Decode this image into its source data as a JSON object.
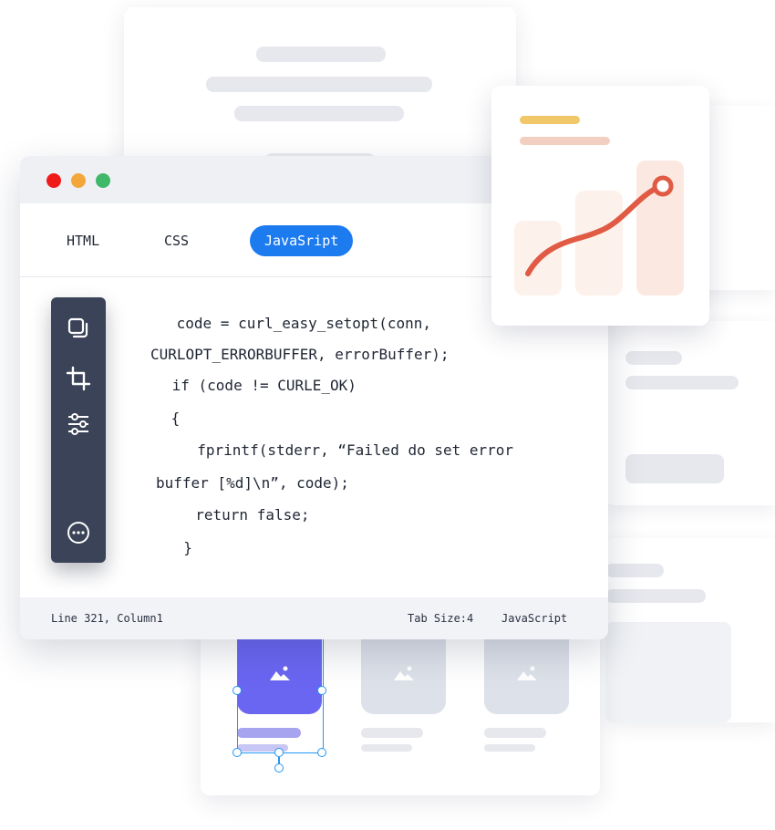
{
  "editor": {
    "tabs": [
      {
        "label": "HTML",
        "active": false
      },
      {
        "label": "CSS",
        "active": false
      },
      {
        "label": "JavaSript",
        "active": true
      }
    ],
    "code_lines": [
      " code = curl_easy_setopt(conn,",
      "CURLOPT_ERRORBUFFER, errorBuffer);",
      " if (code != CURLE_OK)",
      " {",
      "  fprintf(stderr, “Failed do set error",
      "buffer [%d]\\n”, code);",
      "  return false;",
      "  }"
    ],
    "status": {
      "position": "Line 321, Column1",
      "tab_size": "Tab Size:4",
      "language": "JavaScript"
    },
    "toolbar_icons": [
      "copy-icon",
      "crop-icon",
      "sliders-icon",
      "more-icon"
    ]
  },
  "colors": {
    "accent": "#1d7bf0",
    "toolbar_bg": "#3a4357",
    "close_dot": "#ef1b1b",
    "minimize_dot": "#f3a73a",
    "maximize_dot": "#3fb86a",
    "chart_line": "#e05a44",
    "selected_tile": "#6b66f2",
    "selection_outline": "#2196f3"
  },
  "gallery": {
    "tiles": [
      {
        "icon": "image-icon",
        "selected": true
      },
      {
        "icon": "image-icon",
        "selected": false
      },
      {
        "icon": "image-icon",
        "selected": false
      }
    ]
  }
}
